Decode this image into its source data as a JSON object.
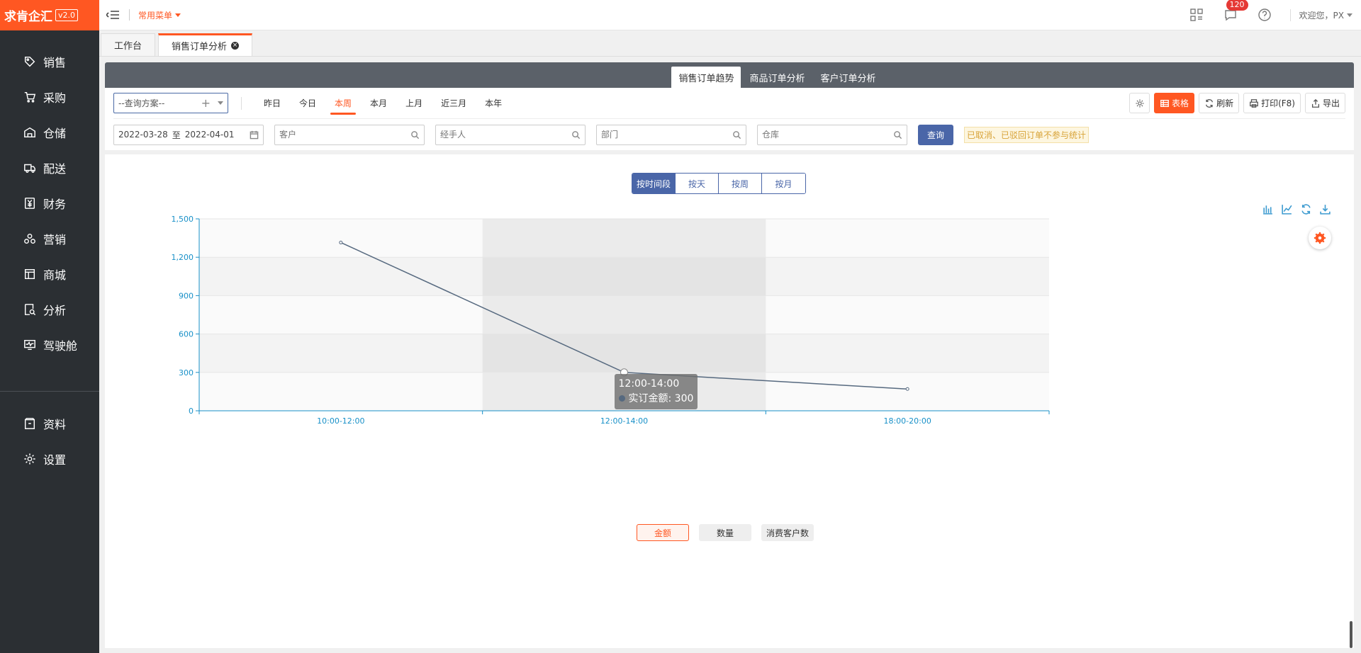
{
  "app": {
    "logo_text": "求肯企汇",
    "version": "v2.0"
  },
  "sidebar": {
    "items": [
      {
        "label": "销售",
        "icon": "tag-icon"
      },
      {
        "label": "采购",
        "icon": "cart-icon"
      },
      {
        "label": "仓储",
        "icon": "warehouse-icon"
      },
      {
        "label": "配送",
        "icon": "truck-icon"
      },
      {
        "label": "财务",
        "icon": "yen-icon"
      },
      {
        "label": "营销",
        "icon": "marketing-icon"
      },
      {
        "label": "商城",
        "icon": "shop-icon"
      },
      {
        "label": "分析",
        "icon": "analysis-icon"
      },
      {
        "label": "驾驶舱",
        "icon": "monitor-icon"
      }
    ],
    "bottom_items": [
      {
        "label": "资料",
        "icon": "archive-icon"
      },
      {
        "label": "设置",
        "icon": "gear-icon"
      }
    ]
  },
  "topbar": {
    "common_menu": "常用菜单",
    "message_count": "120",
    "welcome": "欢迎您，PX"
  },
  "tabs": [
    {
      "label": "工作台",
      "active": false
    },
    {
      "label": "销售订单分析",
      "active": true
    }
  ],
  "subtabs": [
    {
      "label": "销售订单趋势",
      "active": true
    },
    {
      "label": "商品订单分析",
      "active": false
    },
    {
      "label": "客户订单分析",
      "active": false
    }
  ],
  "filters": {
    "scheme_placeholder": "--查询方案--",
    "date_options": [
      {
        "label": "昨日",
        "active": false
      },
      {
        "label": "今日",
        "active": false
      },
      {
        "label": "本周",
        "active": true
      },
      {
        "label": "本月",
        "active": false
      },
      {
        "label": "上月",
        "active": false
      },
      {
        "label": "近三月",
        "active": false
      },
      {
        "label": "本年",
        "active": false
      }
    ],
    "date_start": "2022-03-28",
    "date_sep": "至",
    "date_end": "2022-04-01",
    "customer_placeholder": "客户",
    "handler_placeholder": "经手人",
    "dept_placeholder": "部门",
    "warehouse_placeholder": "仓库",
    "query_label": "查询",
    "notice": "已取消、已驳回订单不参与统计"
  },
  "toolbar": {
    "table_label": "表格",
    "refresh_label": "刷新",
    "print_label": "打印(F8)",
    "export_label": "导出"
  },
  "granularity": [
    {
      "label": "按时间段",
      "active": true
    },
    {
      "label": "按天",
      "active": false
    },
    {
      "label": "按周",
      "active": false
    },
    {
      "label": "按月",
      "active": false
    }
  ],
  "metrics": [
    {
      "label": "金额",
      "active": true
    },
    {
      "label": "数量",
      "active": false
    },
    {
      "label": "消费客户数",
      "active": false
    }
  ],
  "tooltip": {
    "title": "12:00-14:00",
    "series": "实订金额",
    "value": "300"
  },
  "colors": {
    "accent": "#ff5722",
    "primary": "#4a66a8",
    "line": "#56697f",
    "axis": "#1890c8"
  },
  "chart_data": {
    "type": "line",
    "categories": [
      "10:00-12:00",
      "12:00-14:00",
      "18:00-20:00"
    ],
    "series": [
      {
        "name": "实订金额",
        "values": [
          1315,
          300,
          170
        ]
      }
    ],
    "ylim": [
      0,
      1500
    ],
    "yticks": [
      0,
      300,
      600,
      900,
      1200,
      1500
    ],
    "ytick_labels": [
      "0",
      "300",
      "600",
      "900",
      "1,200",
      "1,500"
    ],
    "highlighted_category": "12:00-14:00",
    "grid": true
  }
}
